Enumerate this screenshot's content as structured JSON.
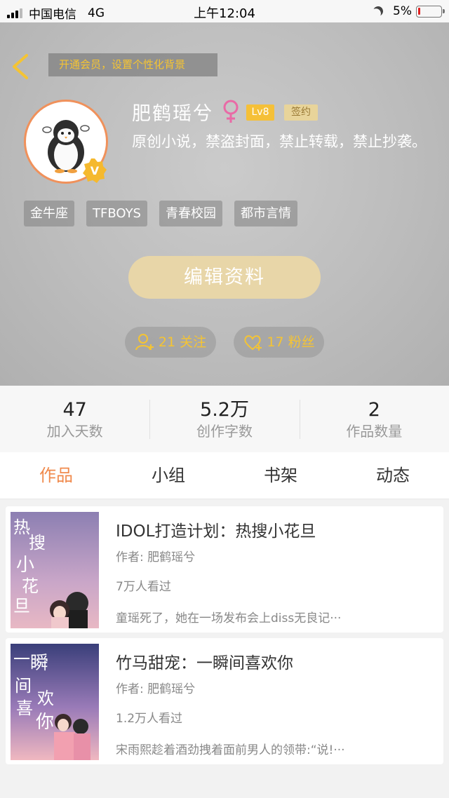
{
  "status_bar": {
    "carrier": "中国电信",
    "network": "4G",
    "time": "上午12:04",
    "battery": "5%",
    "battery_color": "#e02020"
  },
  "profile": {
    "bg_banner": "开通会员，设置个性化背景",
    "username": "肥鹤瑶兮",
    "level": "Lv8",
    "sign_badge": "签约",
    "bio": "原创小说，禁盗封面，禁止转载，禁止抄袭。",
    "tags": [
      "金牛座",
      "TFBOYS",
      "青春校园",
      "都市言情"
    ],
    "edit_button": "编辑资料",
    "following": "21 关注",
    "followers": "17 粉丝",
    "accent_color": "#f5c433"
  },
  "stats": [
    {
      "value": "47",
      "label": "加入天数"
    },
    {
      "value": "5.2万",
      "label": "创作字数"
    },
    {
      "value": "2",
      "label": "作品数量"
    }
  ],
  "tabs": [
    "作品",
    "小组",
    "书架",
    "动态"
  ],
  "active_tab_color": "#f08a4c",
  "works": [
    {
      "title": "IDOL打造计划：热搜小花旦",
      "author": "作者: 肥鹤瑶兮",
      "reads": "7万人看过",
      "desc": "童瑶死了，她在一场发布会上diss无良记···",
      "cover_text": "热搜小花旦"
    },
    {
      "title": "竹马甜宠：一瞬间喜欢你",
      "author": "作者: 肥鹤瑶兮",
      "reads": "1.2万人看过",
      "desc": "宋雨熙趁着酒劲拽着面前男人的领带:“说!···",
      "cover_text": "一瞬间喜欢你"
    }
  ]
}
